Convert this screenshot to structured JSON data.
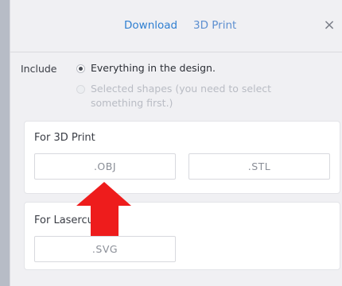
{
  "tabs": [
    {
      "label": "Download",
      "active": true
    },
    {
      "label": "3D Print",
      "active": false
    }
  ],
  "close_glyph": "×",
  "include": {
    "label": "Include",
    "options": [
      {
        "label": "Everything in the design.",
        "checked": true,
        "disabled": false
      },
      {
        "label": "Selected shapes (you need to select something first.)",
        "checked": false,
        "disabled": true
      }
    ]
  },
  "sections": {
    "print3d": {
      "title": "For 3D Print",
      "buttons": [
        ".OBJ",
        ".STL"
      ]
    },
    "lasercut": {
      "title": "For Lasercut",
      "buttons": [
        ".SVG"
      ]
    }
  },
  "colors": {
    "accent": "#2f7fd1",
    "arrow": "#ee1c1c"
  },
  "icons": {
    "close": "close-icon",
    "arrow": "red-arrow-pointer"
  }
}
